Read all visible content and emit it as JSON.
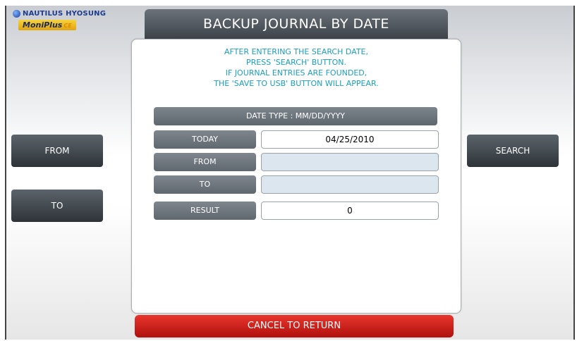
{
  "logo": {
    "company": "NAUTILUS HYOSUNG",
    "product": "MoniPlus",
    "product_suffix": "CE"
  },
  "title": "BACKUP JOURNAL BY DATE",
  "instructions": [
    "AFTER ENTERING THE SEARCH DATE,",
    "PRESS 'SEARCH' BUTTON.",
    "IF JOURNAL ENTRIES ARE FOUNDED,",
    "THE 'SAVE TO USB' BUTTON WILL APPEAR."
  ],
  "date_type": "DATE TYPE :    MM/DD/YYYY",
  "rows": {
    "today": {
      "label": "TODAY",
      "value": "04/25/2010"
    },
    "from": {
      "label": "FROM",
      "value": ""
    },
    "to": {
      "label": "TO",
      "value": ""
    },
    "result": {
      "label": "RESULT",
      "value": "0"
    }
  },
  "buttons": {
    "from": "FROM",
    "to": "TO",
    "search": "SEARCH",
    "cancel": "CANCEL TO RETURN"
  },
  "colors": {
    "instruction_text": "#1aa0c0",
    "cancel_button": "#d02018",
    "title_bar": "#555b61"
  }
}
